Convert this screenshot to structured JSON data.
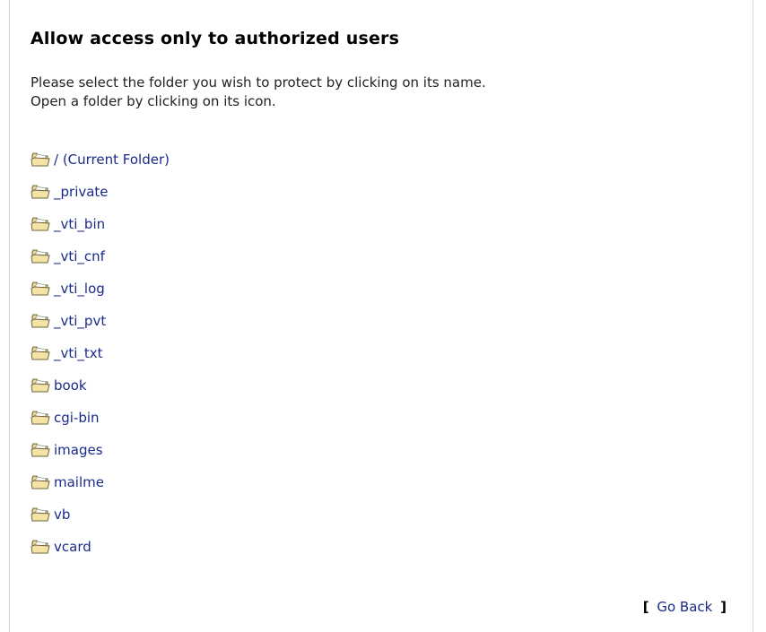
{
  "title": "Allow access only to authorized users",
  "instructions": {
    "line1": "Please select the folder you wish to protect by clicking on its name.",
    "line2": "Open a folder by clicking on its icon."
  },
  "folders": [
    {
      "name": "/ (Current Folder)"
    },
    {
      "name": "_private"
    },
    {
      "name": "_vti_bin"
    },
    {
      "name": "_vti_cnf"
    },
    {
      "name": "_vti_log"
    },
    {
      "name": "_vti_pvt"
    },
    {
      "name": "_vti_txt"
    },
    {
      "name": "book"
    },
    {
      "name": "cgi-bin"
    },
    {
      "name": "images"
    },
    {
      "name": "mailme"
    },
    {
      "name": "vb"
    },
    {
      "name": "vcard"
    }
  ],
  "footer": {
    "open_bracket": "[",
    "go_back_label": "Go Back",
    "close_bracket": "]"
  },
  "colors": {
    "link": "#1a2a8a",
    "folder_fill": "#e8d48a",
    "folder_outline": "#6e6242"
  }
}
